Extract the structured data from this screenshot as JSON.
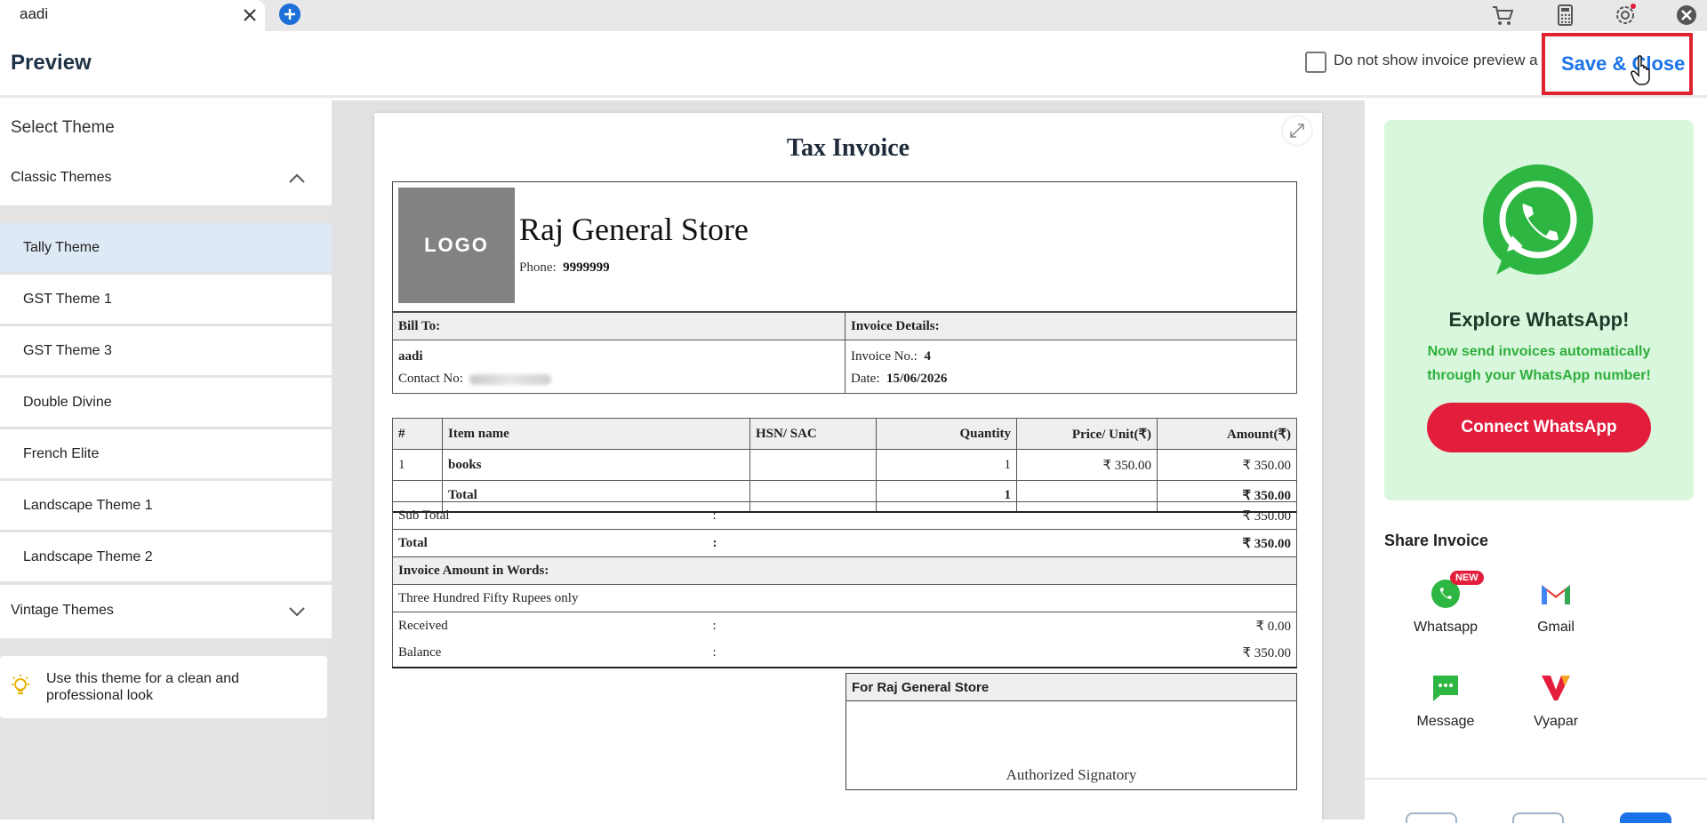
{
  "tab": {
    "title": "aadi"
  },
  "toolbar_icons": [
    "cart-icon",
    "calculator-icon",
    "settings-icon",
    "close-circle-icon"
  ],
  "header": {
    "title": "Preview",
    "checkbox_label": "Do not show invoice preview a",
    "save_label": "Save & Close"
  },
  "sidebar": {
    "heading": "Select Theme",
    "classic_label": "Classic Themes",
    "items": [
      {
        "label": "Tally Theme"
      },
      {
        "label": "GST Theme 1"
      },
      {
        "label": "GST Theme 3"
      },
      {
        "label": "Double Divine"
      },
      {
        "label": "French Elite"
      },
      {
        "label": "Landscape Theme 1"
      },
      {
        "label": "Landscape Theme 2"
      }
    ],
    "vintage_label": "Vintage Themes",
    "tip": "Use this theme for a clean and professional look"
  },
  "invoice": {
    "title": "Tax Invoice",
    "logo_text": "LOGO",
    "store_name": "Raj General Store",
    "phone_label": "Phone:",
    "phone": "9999999",
    "bill_to_label": "Bill To:",
    "customer": "aadi",
    "contact_label": "Contact No:",
    "details_label": "Invoice Details:",
    "invoice_no_label": "Invoice No.:",
    "invoice_no": "4",
    "date_label": "Date:",
    "date": "15/06/2026",
    "columns": [
      "#",
      "Item name",
      "HSN/ SAC",
      "Quantity",
      "Price/ Unit(₹)",
      "Amount(₹)"
    ],
    "rows": [
      {
        "num": "1",
        "name": "books",
        "hsn": "",
        "qty": "1",
        "price": "₹ 350.00",
        "amount": "₹ 350.00"
      }
    ],
    "total_row": {
      "label": "Total",
      "qty": "1",
      "amount": "₹ 350.00"
    },
    "sub_total_label": "Sub Total",
    "sub_total": "₹ 350.00",
    "total_label": "Total",
    "total": "₹ 350.00",
    "words_label": "Invoice Amount in Words:",
    "words": "Three Hundred Fifty Rupees only",
    "received_label": "Received",
    "received": "₹ 0.00",
    "balance_label": "Balance",
    "balance": "₹ 350.00",
    "colon": ":",
    "for_store": "For Raj General Store",
    "signatory": "Authorized Signatory"
  },
  "whatsapp": {
    "title": "Explore WhatsApp!",
    "subtitle": "Now send invoices automatically through your WhatsApp number!",
    "button": "Connect WhatsApp"
  },
  "share": {
    "title": "Share Invoice",
    "new_badge": "NEW",
    "items": [
      {
        "label": "Whatsapp"
      },
      {
        "label": "Gmail"
      },
      {
        "label": "Message"
      },
      {
        "label": "Vyapar"
      }
    ]
  },
  "colors": {
    "accent_blue": "#1a73e8",
    "highlight_red": "#e1232f",
    "whatsapp_green": "#2eae3c",
    "selected_bg": "#dde9f4"
  }
}
